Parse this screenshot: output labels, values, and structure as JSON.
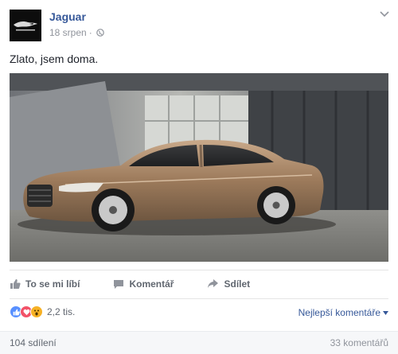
{
  "post": {
    "page_name": "Jaguar",
    "date": "18 srpen",
    "separator": "·",
    "text": "Zlato, jsem doma.",
    "image_icon": "jaguar-xj-car-photo"
  },
  "actions": {
    "like": "To se mi líbí",
    "comment": "Komentář",
    "share": "Sdílet"
  },
  "reactions": {
    "count": "2,2 tis.",
    "types": [
      "like",
      "love",
      "wow"
    ],
    "best_comments": "Nejlepší komentáře"
  },
  "footer": {
    "shares": "104 sdílení",
    "comments": "33 komentářů"
  },
  "colors": {
    "link": "#365899",
    "muted": "#90949c",
    "like": "#5890ff",
    "love": "#f25268",
    "wow": "#f7b125"
  }
}
